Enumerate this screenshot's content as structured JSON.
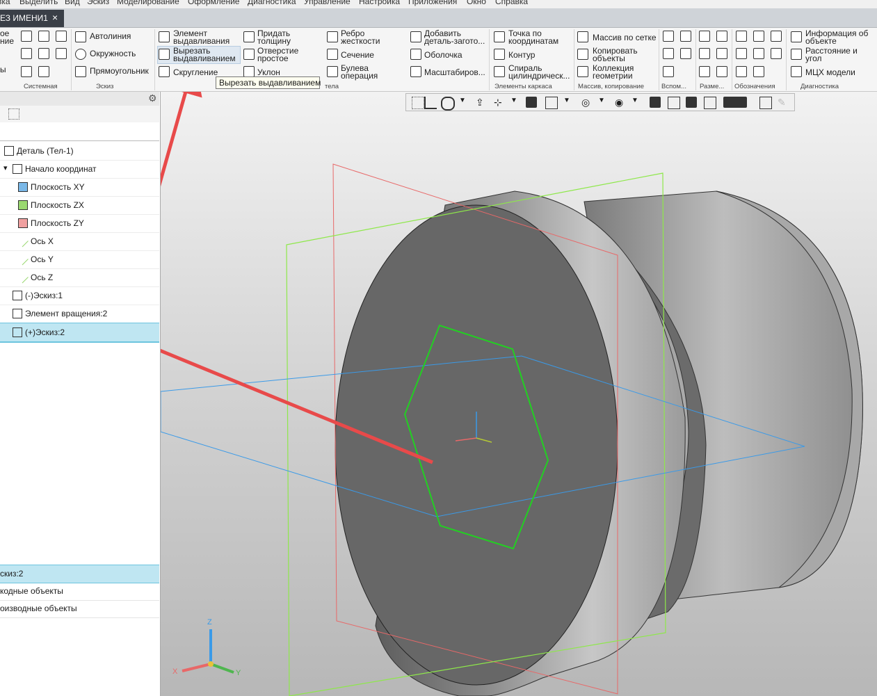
{
  "menu": [
    "вка",
    "Выделить",
    "Вид",
    "Эскиз",
    "Моделирование",
    "Оформление",
    "Диагностика",
    "Управление",
    "Настройка",
    "Приложения",
    "Окно",
    "Справка"
  ],
  "document_tab": {
    "title": "ЕЗ ИМЕНИ1",
    "close": "×"
  },
  "ribbon": {
    "left_stub": [
      "ое",
      "ние",
      "ы"
    ],
    "sketch": [
      "Автолиния",
      "Окружность",
      "Прямоугольник"
    ],
    "elements": [
      [
        "Элемент",
        "выдавливания"
      ],
      [
        "Вырезать",
        "выдавливанием"
      ],
      [
        "Скругление"
      ],
      [
        "Придать",
        "толщину"
      ],
      [
        "Отверстие",
        "простое"
      ],
      [
        "Уклон"
      ],
      [
        "Ребро",
        "жесткости"
      ],
      [
        "Сечение"
      ],
      [
        "Булева",
        "операция"
      ],
      [
        "Добавить",
        "деталь-загото..."
      ],
      [
        "Оболочка"
      ],
      [
        "Масштабиров..."
      ]
    ],
    "frame": [
      [
        "Точка по",
        "координатам"
      ],
      [
        "Контур"
      ],
      [
        "Спираль",
        "цилиндрическ..."
      ]
    ],
    "copy": [
      [
        "Массив по сетке"
      ],
      [
        "Копировать",
        "объекты"
      ],
      [
        "Коллекция",
        "геометрии"
      ]
    ],
    "diag": [
      [
        "Информация об",
        "объекте"
      ],
      [
        "Расстояние и",
        "угол"
      ],
      [
        "МЦХ модели"
      ]
    ],
    "groups": [
      "Системная",
      "Эскиз",
      "тела",
      "Элементы каркаса",
      "Массив, копирование",
      "Вспом...",
      "Разме...",
      "Обозначения",
      "Диагностика"
    ]
  },
  "tooltip": "Вырезать выдавливанием",
  "tree": [
    {
      "label": "Деталь (Тел-1)",
      "icon": "part-icon",
      "indent": 0
    },
    {
      "label": "Начало координат",
      "icon": "origin-icon",
      "indent": 1
    },
    {
      "label": "Плоскость XY",
      "icon": "plane-xy-icon",
      "indent": 2
    },
    {
      "label": "Плоскость ZX",
      "icon": "plane-zx-icon",
      "indent": 2
    },
    {
      "label": "Плоскость ZY",
      "icon": "plane-zy-icon",
      "indent": 2
    },
    {
      "label": "Ось X",
      "icon": "axis-icon",
      "indent": 2
    },
    {
      "label": "Ось Y",
      "icon": "axis-icon",
      "indent": 2
    },
    {
      "label": "Ось Z",
      "icon": "axis-icon",
      "indent": 2
    },
    {
      "label": "(-)Эскиз:1",
      "icon": "sketch-icon",
      "indent": 1
    },
    {
      "label": "Элемент вращения:2",
      "icon": "revolve-icon",
      "indent": 1
    },
    {
      "label": "(+)Эскиз:2",
      "icon": "sketch-icon",
      "indent": 1
    }
  ],
  "properties": {
    "title": "скиз:2",
    "rows": [
      "кодные объекты",
      "оизводные объекты"
    ]
  },
  "triad": {
    "z": "Z",
    "x": "X",
    "y": "Y"
  },
  "colors": {
    "accent": "#6cc4de",
    "arrow": "#e84a4a",
    "sketch": "#22d022",
    "plane_red": "#e86868",
    "plane_green": "#8ee84a",
    "plane_blue": "#3a9ae8"
  }
}
